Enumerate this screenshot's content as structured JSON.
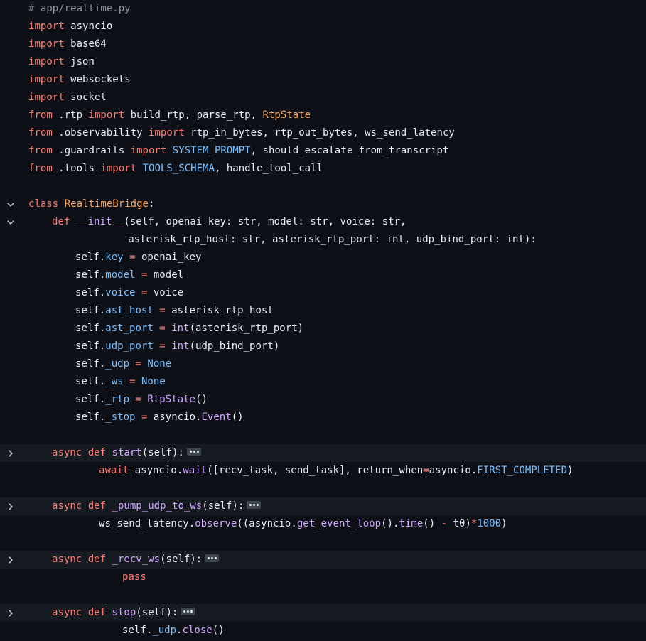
{
  "file_comment": "# app/realtime.py",
  "colors": {
    "keyword": "#ff7b72",
    "class_name": "#ffa657",
    "function": "#d2a8ff",
    "attribute": "#79c0ff",
    "comment": "#8b949e",
    "plain": "#e6edf3",
    "background": "#0d1117",
    "folded_background": "#161b22"
  },
  "lines": [
    {
      "indent": 0,
      "tokens": [
        {
          "t": "cm",
          "v": "# app/realtime.py"
        }
      ]
    },
    {
      "indent": 0,
      "tokens": [
        {
          "t": "kw",
          "v": "import"
        },
        {
          "t": "plain",
          "v": " asyncio"
        }
      ]
    },
    {
      "indent": 0,
      "tokens": [
        {
          "t": "kw",
          "v": "import"
        },
        {
          "t": "plain",
          "v": " base64"
        }
      ]
    },
    {
      "indent": 0,
      "tokens": [
        {
          "t": "kw",
          "v": "import"
        },
        {
          "t": "plain",
          "v": " json"
        }
      ]
    },
    {
      "indent": 0,
      "tokens": [
        {
          "t": "kw",
          "v": "import"
        },
        {
          "t": "plain",
          "v": " websockets"
        }
      ]
    },
    {
      "indent": 0,
      "tokens": [
        {
          "t": "kw",
          "v": "import"
        },
        {
          "t": "plain",
          "v": " socket"
        }
      ]
    },
    {
      "indent": 0,
      "tokens": [
        {
          "t": "kw",
          "v": "from"
        },
        {
          "t": "plain",
          "v": " .rtp "
        },
        {
          "t": "kw",
          "v": "import"
        },
        {
          "t": "plain",
          "v": " build_rtp, parse_rtp, "
        },
        {
          "t": "cls",
          "v": "RtpState"
        }
      ]
    },
    {
      "indent": 0,
      "tokens": [
        {
          "t": "kw",
          "v": "from"
        },
        {
          "t": "plain",
          "v": " .observability "
        },
        {
          "t": "kw",
          "v": "import"
        },
        {
          "t": "plain",
          "v": " rtp_in_bytes, rtp_out_bytes, ws_send_latency"
        }
      ]
    },
    {
      "indent": 0,
      "tokens": [
        {
          "t": "kw",
          "v": "from"
        },
        {
          "t": "plain",
          "v": " .guardrails "
        },
        {
          "t": "kw",
          "v": "import"
        },
        {
          "t": "plain",
          "v": " "
        },
        {
          "t": "attr",
          "v": "SYSTEM_PROMPT"
        },
        {
          "t": "plain",
          "v": ", should_escalate_from_transcript"
        }
      ]
    },
    {
      "indent": 0,
      "tokens": [
        {
          "t": "kw",
          "v": "from"
        },
        {
          "t": "plain",
          "v": " .tools "
        },
        {
          "t": "kw",
          "v": "import"
        },
        {
          "t": "plain",
          "v": " "
        },
        {
          "t": "attr",
          "v": "TOOLS_SCHEMA"
        },
        {
          "t": "plain",
          "v": ", handle_tool_call"
        }
      ]
    },
    {
      "indent": 0,
      "tokens": []
    },
    {
      "indent": 0,
      "fold": "expanded",
      "tokens": [
        {
          "t": "kw",
          "v": "class"
        },
        {
          "t": "plain",
          "v": " "
        },
        {
          "t": "cls",
          "v": "RealtimeBridge"
        },
        {
          "t": "plain",
          "v": ":"
        }
      ]
    },
    {
      "indent": 4,
      "fold": "expanded",
      "tokens": [
        {
          "t": "kw",
          "v": "def"
        },
        {
          "t": "plain",
          "v": " "
        },
        {
          "t": "fn",
          "v": "__init__"
        },
        {
          "t": "plain",
          "v": "(self, openai_key: str, model: str, voice: str,"
        }
      ]
    },
    {
      "indent": 17,
      "tokens": [
        {
          "t": "plain",
          "v": "asterisk_rtp_host: str, asterisk_rtp_port: int, udp_bind_port: int):"
        }
      ]
    },
    {
      "indent": 8,
      "tokens": [
        {
          "t": "plain",
          "v": "self."
        },
        {
          "t": "attr",
          "v": "key"
        },
        {
          "t": "plain",
          "v": " "
        },
        {
          "t": "kw",
          "v": "="
        },
        {
          "t": "plain",
          "v": " openai_key"
        }
      ]
    },
    {
      "indent": 8,
      "tokens": [
        {
          "t": "plain",
          "v": "self."
        },
        {
          "t": "attr",
          "v": "model"
        },
        {
          "t": "plain",
          "v": " "
        },
        {
          "t": "kw",
          "v": "="
        },
        {
          "t": "plain",
          "v": " model"
        }
      ]
    },
    {
      "indent": 8,
      "tokens": [
        {
          "t": "plain",
          "v": "self."
        },
        {
          "t": "attr",
          "v": "voice"
        },
        {
          "t": "plain",
          "v": " "
        },
        {
          "t": "kw",
          "v": "="
        },
        {
          "t": "plain",
          "v": " voice"
        }
      ]
    },
    {
      "indent": 8,
      "tokens": [
        {
          "t": "plain",
          "v": "self."
        },
        {
          "t": "attr",
          "v": "ast_host"
        },
        {
          "t": "plain",
          "v": " "
        },
        {
          "t": "kw",
          "v": "="
        },
        {
          "t": "plain",
          "v": " asterisk_rtp_host"
        }
      ]
    },
    {
      "indent": 8,
      "tokens": [
        {
          "t": "plain",
          "v": "self."
        },
        {
          "t": "attr",
          "v": "ast_port"
        },
        {
          "t": "plain",
          "v": " "
        },
        {
          "t": "kw",
          "v": "="
        },
        {
          "t": "plain",
          "v": " "
        },
        {
          "t": "fn",
          "v": "int"
        },
        {
          "t": "plain",
          "v": "(asterisk_rtp_port)"
        }
      ]
    },
    {
      "indent": 8,
      "tokens": [
        {
          "t": "plain",
          "v": "self."
        },
        {
          "t": "attr",
          "v": "udp_port"
        },
        {
          "t": "plain",
          "v": " "
        },
        {
          "t": "kw",
          "v": "="
        },
        {
          "t": "plain",
          "v": " "
        },
        {
          "t": "fn",
          "v": "int"
        },
        {
          "t": "plain",
          "v": "(udp_bind_port)"
        }
      ]
    },
    {
      "indent": 8,
      "tokens": [
        {
          "t": "plain",
          "v": "self."
        },
        {
          "t": "attr",
          "v": "_udp"
        },
        {
          "t": "plain",
          "v": " "
        },
        {
          "t": "kw",
          "v": "="
        },
        {
          "t": "plain",
          "v": " "
        },
        {
          "t": "attr",
          "v": "None"
        }
      ]
    },
    {
      "indent": 8,
      "tokens": [
        {
          "t": "plain",
          "v": "self."
        },
        {
          "t": "attr",
          "v": "_ws"
        },
        {
          "t": "plain",
          "v": " "
        },
        {
          "t": "kw",
          "v": "="
        },
        {
          "t": "plain",
          "v": " "
        },
        {
          "t": "attr",
          "v": "None"
        }
      ]
    },
    {
      "indent": 8,
      "tokens": [
        {
          "t": "plain",
          "v": "self."
        },
        {
          "t": "attr",
          "v": "_rtp"
        },
        {
          "t": "plain",
          "v": " "
        },
        {
          "t": "kw",
          "v": "="
        },
        {
          "t": "plain",
          "v": " "
        },
        {
          "t": "fn",
          "v": "RtpState"
        },
        {
          "t": "plain",
          "v": "()"
        }
      ]
    },
    {
      "indent": 8,
      "tokens": [
        {
          "t": "plain",
          "v": "self."
        },
        {
          "t": "attr",
          "v": "_stop"
        },
        {
          "t": "plain",
          "v": " "
        },
        {
          "t": "kw",
          "v": "="
        },
        {
          "t": "plain",
          "v": " asyncio."
        },
        {
          "t": "fn",
          "v": "Event"
        },
        {
          "t": "plain",
          "v": "()"
        }
      ]
    },
    {
      "indent": 0,
      "tokens": []
    },
    {
      "indent": 4,
      "fold": "collapsed",
      "tokens": [
        {
          "t": "kw",
          "v": "async"
        },
        {
          "t": "plain",
          "v": " "
        },
        {
          "t": "kw",
          "v": "def"
        },
        {
          "t": "plain",
          "v": " "
        },
        {
          "t": "fn",
          "v": "start"
        },
        {
          "t": "plain",
          "v": "(self):"
        }
      ]
    },
    {
      "indent": 12,
      "tokens": [
        {
          "t": "kw",
          "v": "await"
        },
        {
          "t": "plain",
          "v": " asyncio."
        },
        {
          "t": "fn",
          "v": "wait"
        },
        {
          "t": "plain",
          "v": "([recv_task, send_task], return_when"
        },
        {
          "t": "kw",
          "v": "="
        },
        {
          "t": "plain",
          "v": "asyncio."
        },
        {
          "t": "attr",
          "v": "FIRST_COMPLETED"
        },
        {
          "t": "plain",
          "v": ")"
        }
      ]
    },
    {
      "indent": 0,
      "tokens": []
    },
    {
      "indent": 4,
      "fold": "collapsed",
      "tokens": [
        {
          "t": "kw",
          "v": "async"
        },
        {
          "t": "plain",
          "v": " "
        },
        {
          "t": "kw",
          "v": "def"
        },
        {
          "t": "plain",
          "v": " "
        },
        {
          "t": "fn",
          "v": "_pump_udp_to_ws"
        },
        {
          "t": "plain",
          "v": "(self):"
        }
      ]
    },
    {
      "indent": 12,
      "tokens": [
        {
          "t": "plain",
          "v": "ws_send_latency."
        },
        {
          "t": "fn",
          "v": "observe"
        },
        {
          "t": "plain",
          "v": "((asyncio."
        },
        {
          "t": "fn",
          "v": "get_event_loop"
        },
        {
          "t": "plain",
          "v": "()."
        },
        {
          "t": "fn",
          "v": "time"
        },
        {
          "t": "plain",
          "v": "() "
        },
        {
          "t": "kw",
          "v": "-"
        },
        {
          "t": "plain",
          "v": " t0)"
        },
        {
          "t": "kw",
          "v": "*"
        },
        {
          "t": "attr",
          "v": "1000"
        },
        {
          "t": "plain",
          "v": ")"
        }
      ]
    },
    {
      "indent": 0,
      "tokens": []
    },
    {
      "indent": 4,
      "fold": "collapsed",
      "tokens": [
        {
          "t": "kw",
          "v": "async"
        },
        {
          "t": "plain",
          "v": " "
        },
        {
          "t": "kw",
          "v": "def"
        },
        {
          "t": "plain",
          "v": " "
        },
        {
          "t": "fn",
          "v": "_recv_ws"
        },
        {
          "t": "plain",
          "v": "(self):"
        }
      ]
    },
    {
      "indent": 16,
      "tokens": [
        {
          "t": "kw",
          "v": "pass"
        }
      ]
    },
    {
      "indent": 0,
      "tokens": []
    },
    {
      "indent": 4,
      "fold": "collapsed",
      "tokens": [
        {
          "t": "kw",
          "v": "async"
        },
        {
          "t": "plain",
          "v": " "
        },
        {
          "t": "kw",
          "v": "def"
        },
        {
          "t": "plain",
          "v": " "
        },
        {
          "t": "fn",
          "v": "stop"
        },
        {
          "t": "plain",
          "v": "(self):"
        }
      ]
    },
    {
      "indent": 16,
      "tokens": [
        {
          "t": "plain",
          "v": "self."
        },
        {
          "t": "attr",
          "v": "_udp"
        },
        {
          "t": "plain",
          "v": "."
        },
        {
          "t": "fn",
          "v": "close"
        },
        {
          "t": "plain",
          "v": "()"
        }
      ]
    }
  ]
}
